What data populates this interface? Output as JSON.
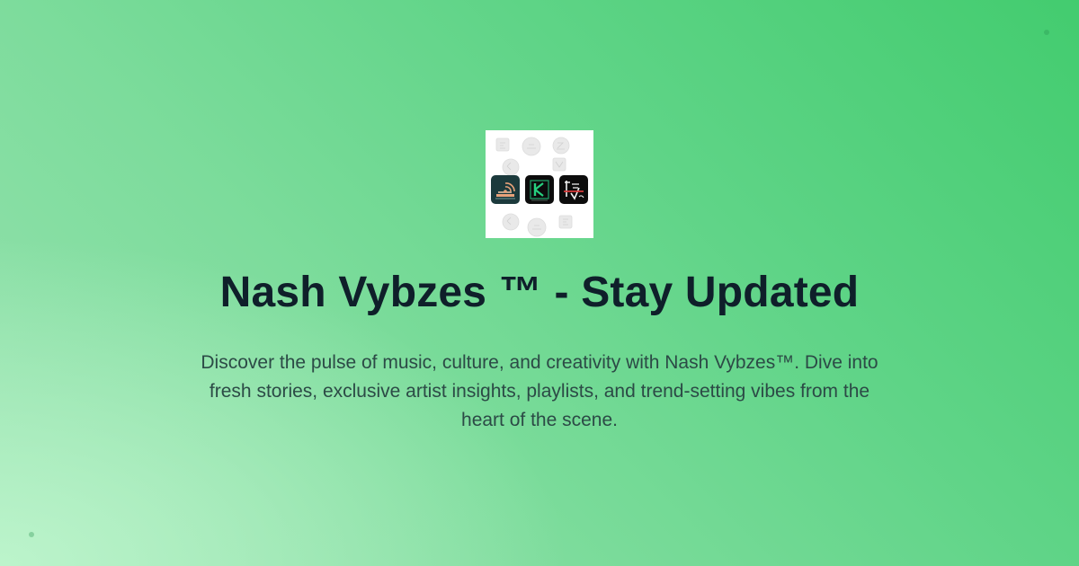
{
  "page": {
    "title": "Nash Vybzes ™ - Stay Updated",
    "description": "Discover the pulse of music, culture, and creativity with Nash Vybzes™. Dive into fresh stories, exclusive artist insights, playlists, and trend-setting vibes from the heart of the scene."
  },
  "logo": {
    "icons": [
      "radio-wave-icon",
      "k-letter-icon",
      "signature-icon"
    ]
  },
  "colors": {
    "background_start": "#43cc6f",
    "background_end": "#bdf3cc",
    "title_text": "#0f1f2a",
    "description_text": "#2c4a46",
    "logo_tile": "#1a1a1a"
  }
}
